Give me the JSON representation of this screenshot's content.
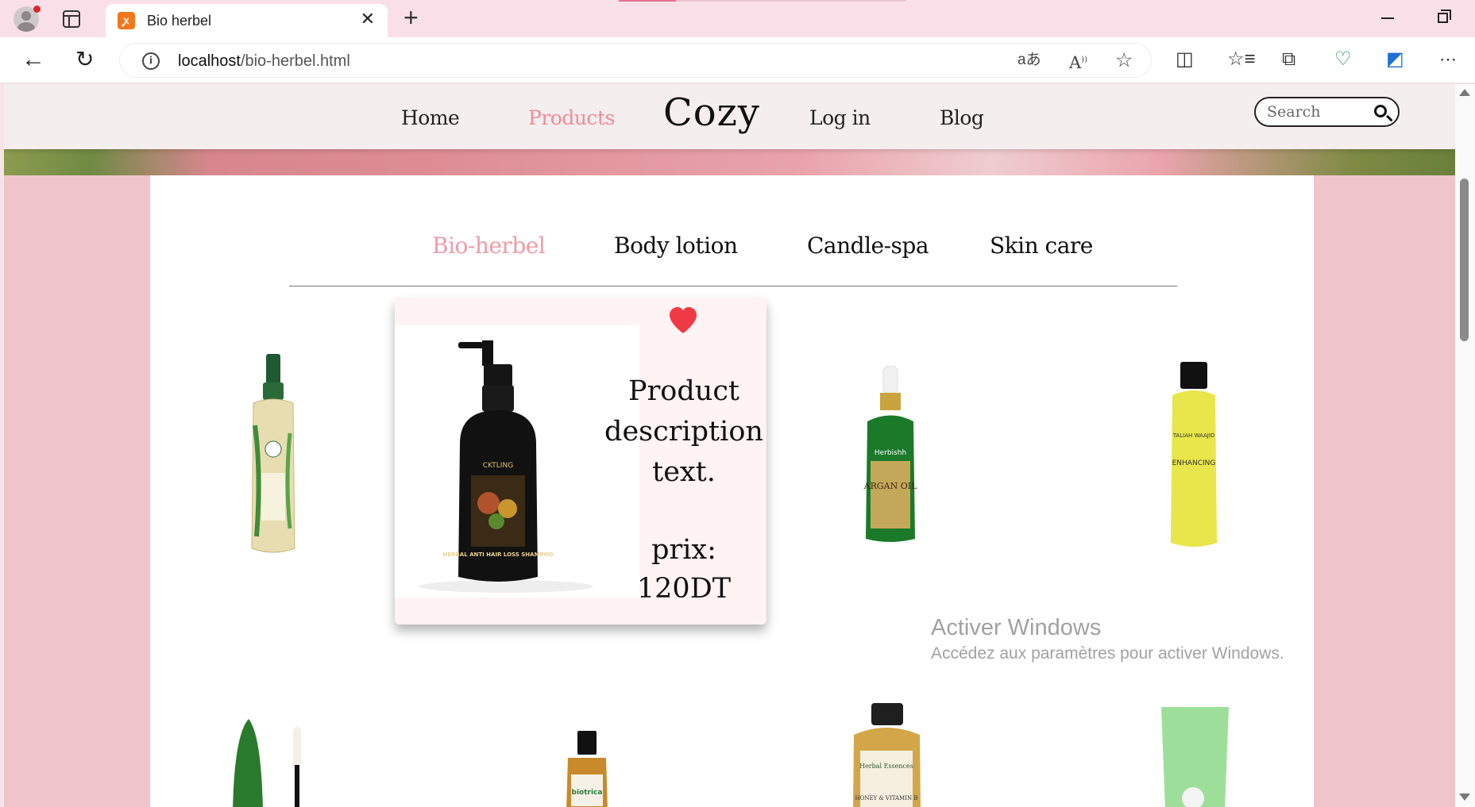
{
  "browser": {
    "tab_title": "Bio herbel",
    "tab_favicon": "xampp-icon",
    "url_host": "localhost",
    "url_path": "/bio-herbel.html"
  },
  "nav": {
    "home": "Home",
    "products": "Products",
    "brand": "Cozy",
    "login": "Log in",
    "blog": "Blog",
    "search_placeholder": "Search"
  },
  "categories": [
    {
      "label": "Bio-herbel",
      "active": true
    },
    {
      "label": "Body lotion",
      "active": false
    },
    {
      "label": "Candle-spa",
      "active": false
    },
    {
      "label": "Skin care",
      "active": false
    }
  ],
  "featured": {
    "description": "Product description text.",
    "price_label": "prix:",
    "price_value": "120DT",
    "bottle_label": "HERBAL ANTI HAIR LOSS SHAMPOO",
    "bottle_brand": "CKTLING"
  },
  "products": {
    "argan_brand": "Herbishh",
    "argan_label": "ARGAN OIL",
    "talian_brand": "TALIAH WAAJID",
    "talian_label": "ENHANCING",
    "biotrica": "biotrica",
    "herbal_essences": "Herbal Essences",
    "honey_label": "HONEY & VITAMIN B"
  },
  "watermark": {
    "line1": "Activer Windows",
    "line2": "Accédez aux paramètres pour activer Windows."
  },
  "colors": {
    "accent": "#ee8c96",
    "page_bg": "#efc4cb",
    "heart": "#ef3a44"
  }
}
